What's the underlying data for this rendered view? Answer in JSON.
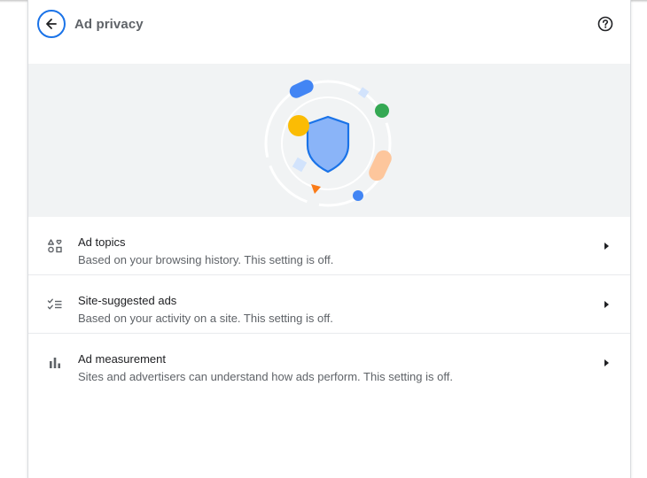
{
  "header": {
    "title": "Ad privacy",
    "back_icon": "arrow-back-icon",
    "help_icon": "help-circle-icon"
  },
  "colors": {
    "accent": "#1a73e8",
    "banner_bg": "#f1f3f4",
    "shield_fill": "#8ab4f8",
    "yellow": "#fbbc04",
    "green": "#34a853",
    "orange": "#fa7b17",
    "peach": "#fdc69c"
  },
  "settings": [
    {
      "title": "Ad topics",
      "description": "Based on your browsing history. This setting is off.",
      "icon": "ad-topics-icon"
    },
    {
      "title": "Site-suggested ads",
      "description": "Based on your activity on a site. This setting is off.",
      "icon": "checklist-icon"
    },
    {
      "title": "Ad measurement",
      "description": "Sites and advertisers can understand how ads perform. This setting is off.",
      "icon": "bar-chart-icon"
    }
  ]
}
